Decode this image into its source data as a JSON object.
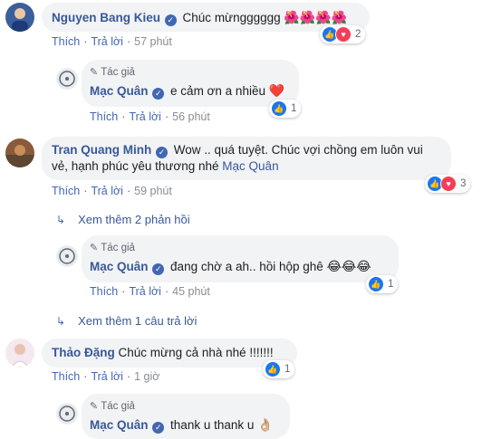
{
  "actions": {
    "like": "Thích",
    "reply": "Trả lời"
  },
  "author_badge": "Tác giả",
  "comments": [
    {
      "name": "Nguyen Bang Kieu",
      "text": "Chúc mừngggggg",
      "emoji": "🌺🌺🌺🌺",
      "time": "57 phút",
      "reactions": "2"
    },
    {
      "name": "Mạc Quân",
      "text": "e cảm ơn a nhiều",
      "emoji": "❤️",
      "time": "56 phút",
      "reactions": "1"
    },
    {
      "name": "Tran Quang Minh",
      "text": "Wow .. quá tuyệt. Chúc vợi chồng em luôn vui",
      "text2": "vẻ, hạnh phúc yêu thương nhé",
      "mention": "Mạc Quân",
      "time": "59 phút",
      "reactions": "3"
    },
    {
      "name": "Mạc Quân",
      "text": "đang chờ a ah.. hồi hộp ghê",
      "emoji": "😂😂😂",
      "time": "45 phút",
      "reactions": "1"
    },
    {
      "name": "Thảo Đặng",
      "text": "Chúc mừng cả nhà nhé !!!!!!!",
      "time": "1 giờ",
      "reactions": "1"
    },
    {
      "name": "Mạc Quân",
      "text": "thank u thank u",
      "emoji": "👌🏼"
    }
  ],
  "more_replies": [
    "Xem thêm 2 phản hồi",
    "Xem thêm 1 câu trả lời"
  ]
}
